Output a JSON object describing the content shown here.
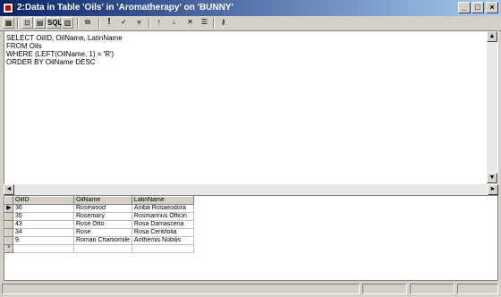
{
  "window": {
    "title": "2:Data in Table 'Oils' in 'Aromatherapy' on 'BUNNY'"
  },
  "toolbar": {
    "items": [
      "SQL"
    ]
  },
  "sql": {
    "lines": [
      "SELECT    OilID, OilName, LatinName",
      "FROM      Oils",
      "WHERE     (LEFT(OilName, 1) = 'R')",
      "ORDER BY  OilName DESC"
    ]
  },
  "grid": {
    "columns": [
      "OilID",
      "OilName",
      "LatinName"
    ],
    "rows": [
      [
        "36",
        "Rosewood",
        "Aniba Rosaeodora"
      ],
      [
        "35",
        "Rosemary",
        "Rosmarinus Officin"
      ],
      [
        "43",
        "Rose Otto",
        "Rosa Damascena"
      ],
      [
        "34",
        "Rose",
        "Rosa Centifolia"
      ],
      [
        "9",
        "Roman Chamomile",
        "Anthemis Nobilis"
      ]
    ],
    "new_row_marker": "*"
  }
}
